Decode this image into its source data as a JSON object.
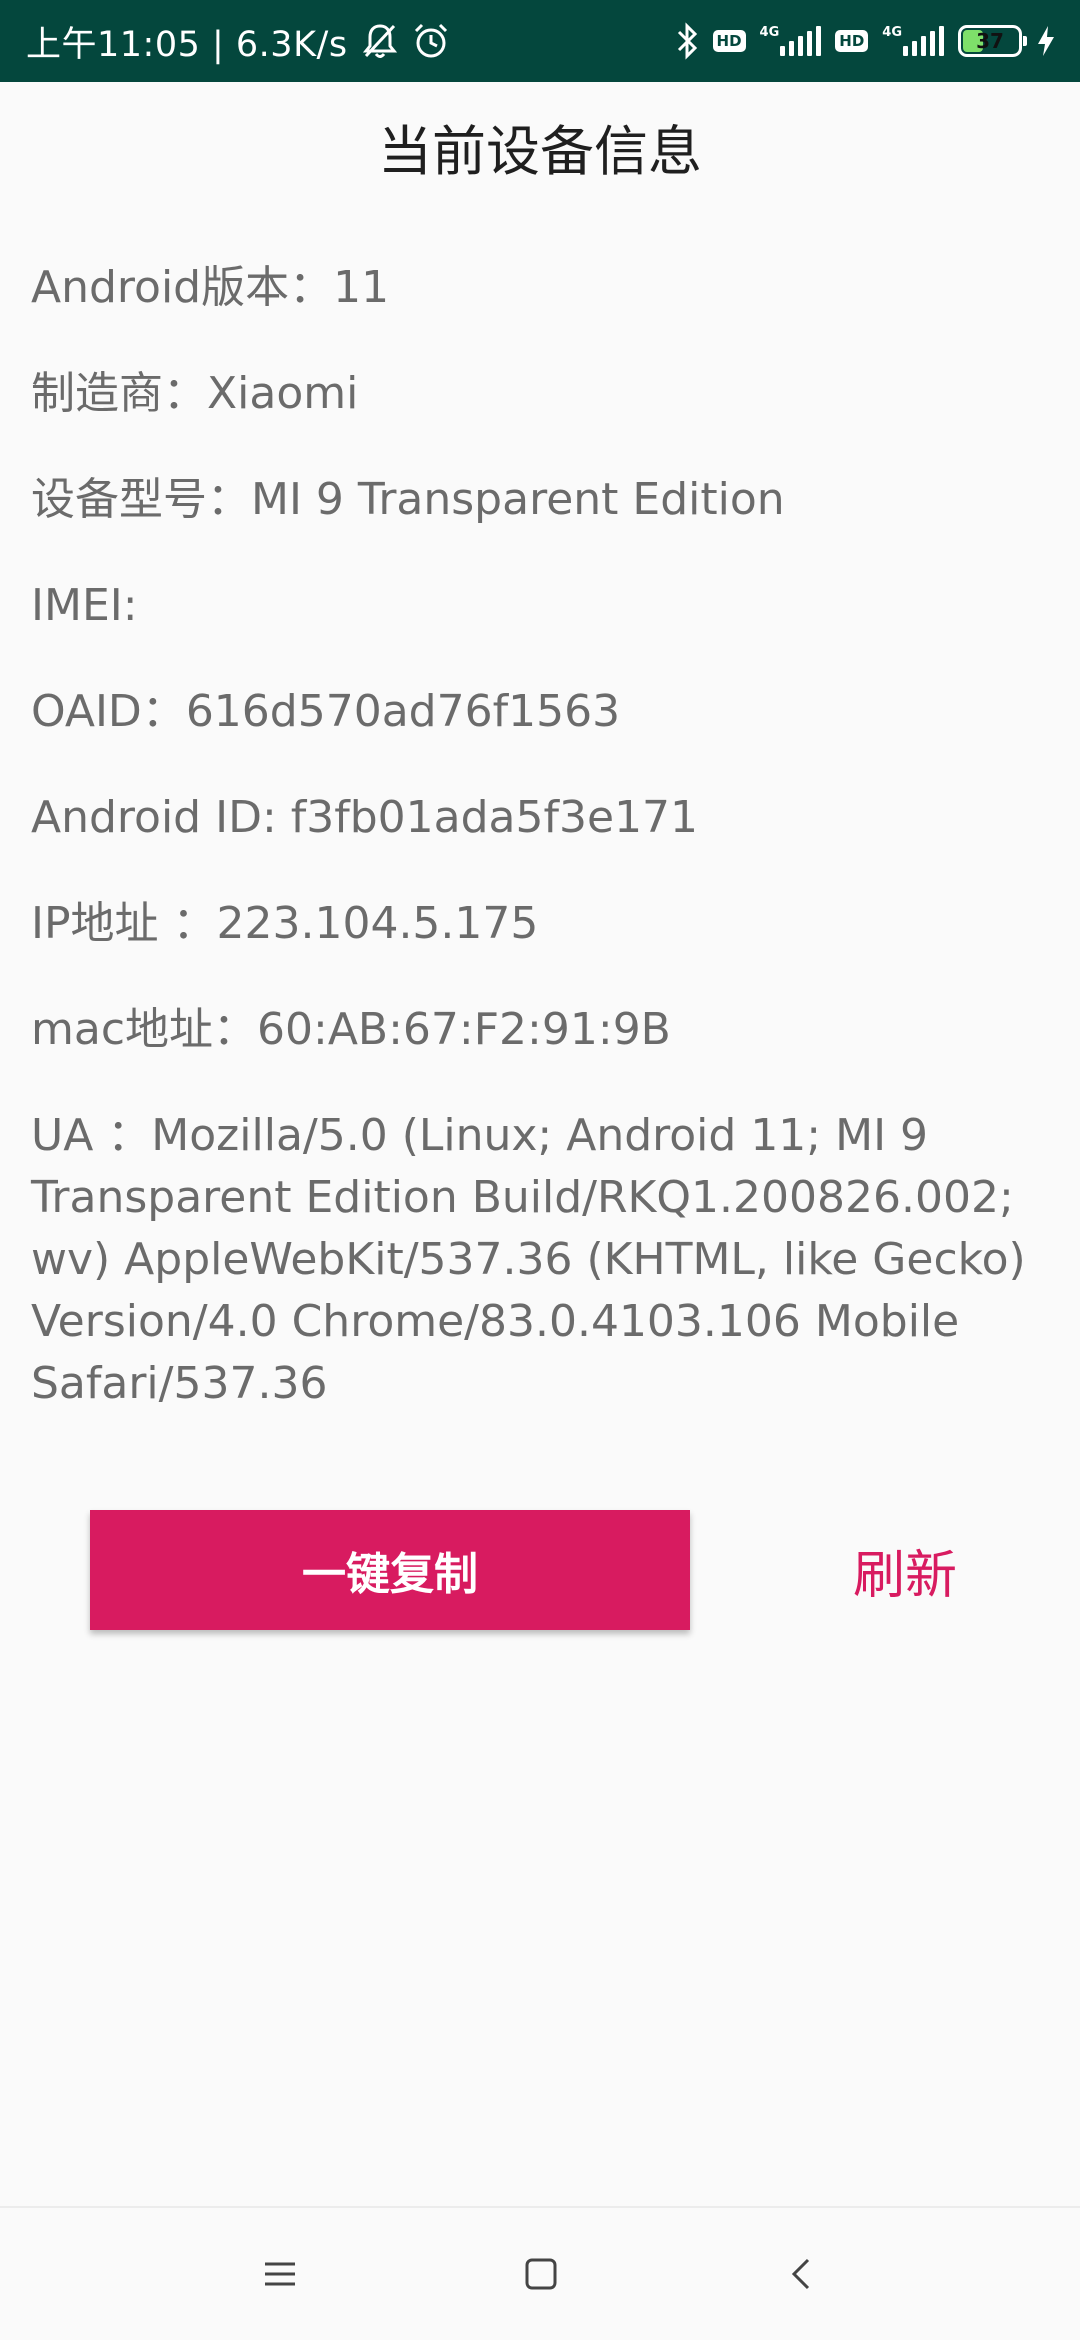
{
  "status_bar": {
    "time_speed": "上午11:05 | 6.3K/s",
    "net_label_1": "4G",
    "net_label_2": "4G",
    "hd_label": "HD",
    "battery_level": "37",
    "battery_fraction": 0.37,
    "icons": [
      "bell-off-icon",
      "alarm-icon",
      "bluetooth-icon",
      "hd-icon",
      "signal-icon",
      "battery-icon",
      "charging-icon"
    ]
  },
  "page": {
    "title": "当前设备信息"
  },
  "info": {
    "android_version": "Android版本：11",
    "manufacturer": "制造商：Xiaomi",
    "model": "设备型号：MI 9 Transparent Edition",
    "imei": "IMEI:",
    "oaid": "OAID：616d570ad76f1563",
    "android_id": "Android ID:   f3fb01ada5f3e171",
    "ip": "IP地址   ：223.104.5.175",
    "mac": "mac地址：60:AB:67:F2:91:9B",
    "ua": "UA     ：Mozilla/5.0 (Linux; Android 11; MI 9 Transparent Edition Build/RKQ1.200826.002; wv) AppleWebKit/537.36 (KHTML, like Gecko) Version/4.0 Chrome/83.0.4103.106 Mobile Safari/537.36"
  },
  "actions": {
    "copy_label": "一键复制",
    "refresh_label": "刷新"
  },
  "colors": {
    "status_bar": "#04473d",
    "accent": "#d81b60",
    "background": "#fafafa"
  },
  "nav": {
    "icons": [
      "menu-icon",
      "home-icon",
      "back-icon"
    ]
  }
}
